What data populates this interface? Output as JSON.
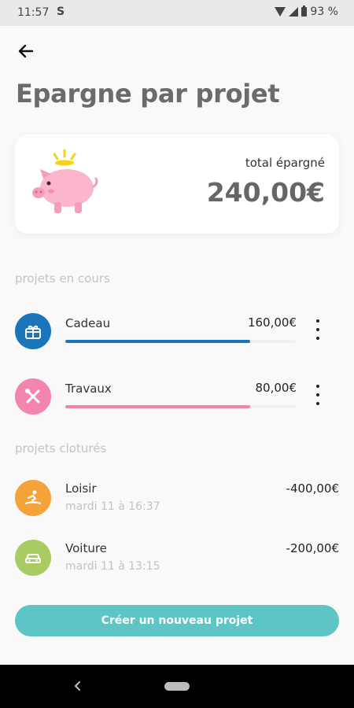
{
  "status_bar": {
    "time": "11:57",
    "notification": "S",
    "battery": "93 %"
  },
  "page_title": "Epargne par projet",
  "summary": {
    "label": "total épargné",
    "amount": "240,00€",
    "icon": "piggy-bank-icon"
  },
  "sections": {
    "ongoing": "projets en cours",
    "closed": "projets cloturés"
  },
  "ongoing_projects": [
    {
      "name": "Cadeau",
      "amount": "160,00€",
      "icon": "gift-icon",
      "color": "#1b75bb",
      "progress": 0.8
    },
    {
      "name": "Travaux",
      "amount": "80,00€",
      "icon": "tools-icon",
      "color": "#f284ad",
      "progress": 0.8
    }
  ],
  "closed_projects": [
    {
      "name": "Loisir",
      "date": "mardi 11 à 16:37",
      "amount": "-400,00€",
      "icon": "surf-icon",
      "color": "#f5a23b"
    },
    {
      "name": "Voiture",
      "date": "mardi 11 à 13:15",
      "amount": "-200,00€",
      "icon": "car-icon",
      "color": "#a9cb62"
    }
  ],
  "create_button": "Créer un nouveau projet"
}
